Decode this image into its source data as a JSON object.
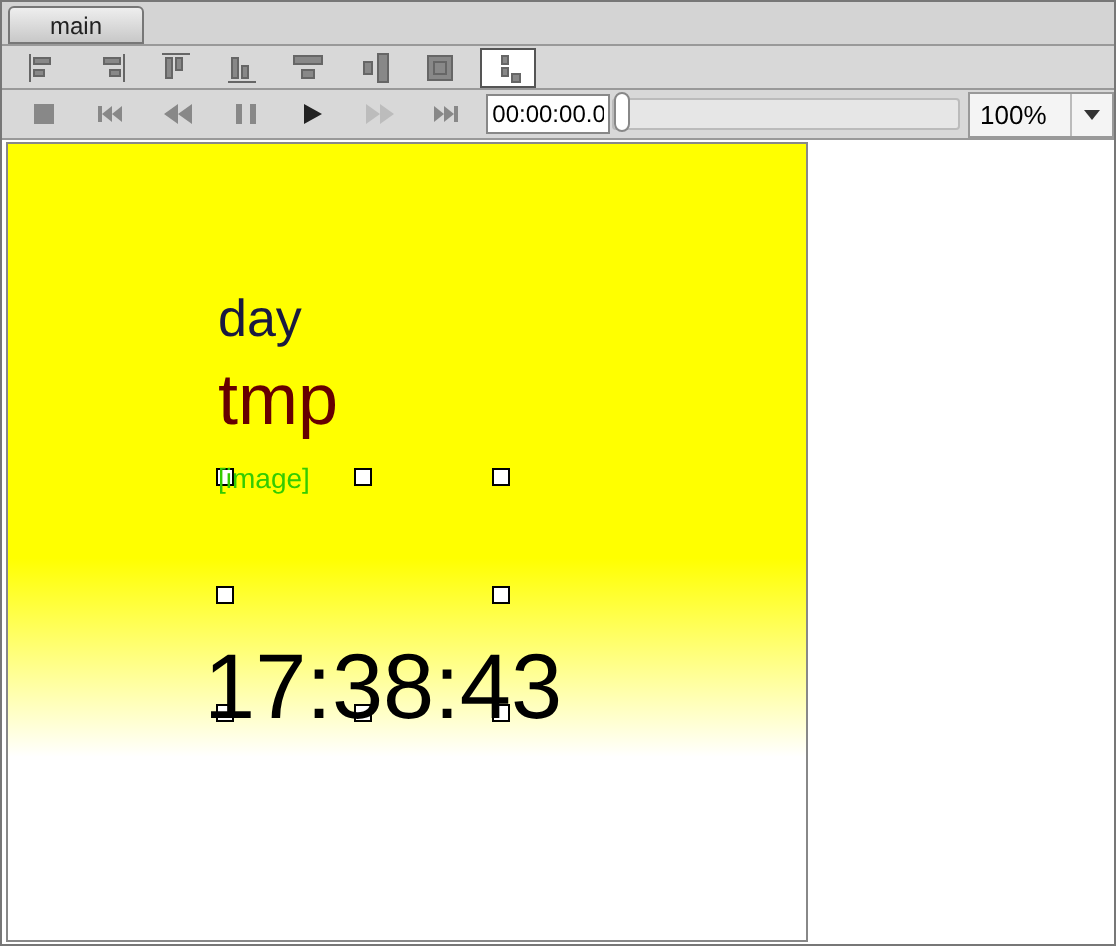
{
  "tabs": [
    {
      "label": "main",
      "selected": true
    }
  ],
  "align_tools": [
    {
      "kind": "align-left",
      "on": false
    },
    {
      "kind": "align-right",
      "on": false
    },
    {
      "kind": "align-top",
      "on": false
    },
    {
      "kind": "align-bottom",
      "on": false
    },
    {
      "kind": "center-horizontal",
      "on": false
    },
    {
      "kind": "center-vertical",
      "on": false
    },
    {
      "kind": "center-both",
      "on": false
    },
    {
      "kind": "snap",
      "on": true
    }
  ],
  "playback": {
    "buttons": [
      {
        "kind": "stop",
        "disabled": false
      },
      {
        "kind": "first",
        "disabled": false
      },
      {
        "kind": "rewind",
        "disabled": false
      },
      {
        "kind": "pause",
        "disabled": false
      },
      {
        "kind": "play",
        "disabled": false
      },
      {
        "kind": "forward",
        "disabled": true
      },
      {
        "kind": "last",
        "disabled": false
      }
    ],
    "time": "00:00:00.0",
    "seek": {
      "level": 0
    },
    "zoom": "100%"
  },
  "canvas": {
    "items": [
      {
        "kind": "text",
        "text": "day",
        "color": "#1a1a40"
      },
      {
        "kind": "text",
        "text": "tmp",
        "color": "#660000"
      },
      {
        "kind": "image",
        "text": "[image]",
        "color": "#33cc00",
        "selected": true
      },
      {
        "kind": "text",
        "text": "17:38:43",
        "color": "#000000"
      }
    ]
  }
}
